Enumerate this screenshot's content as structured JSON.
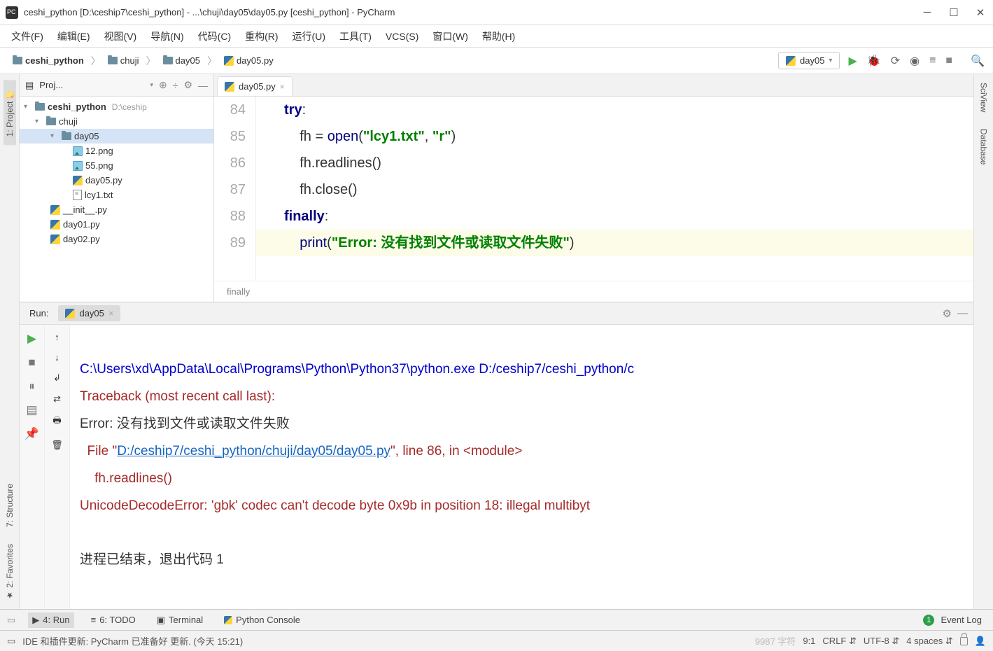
{
  "window": {
    "title": "ceshi_python [D:\\ceship7\\ceshi_python] - ...\\chuji\\day05\\day05.py [ceshi_python] - PyCharm"
  },
  "menu": [
    "文件(F)",
    "编辑(E)",
    "视图(V)",
    "导航(N)",
    "代码(C)",
    "重构(R)",
    "运行(U)",
    "工具(T)",
    "VCS(S)",
    "窗口(W)",
    "帮助(H)"
  ],
  "breadcrumb": {
    "items": [
      "ceshi_python",
      "chuji",
      "day05",
      "day05.py"
    ]
  },
  "runconfig": "day05",
  "project": {
    "title": "Proj...",
    "root": {
      "name": "ceshi_python",
      "path": "D:\\ceship"
    },
    "tree": {
      "chuji": "chuji",
      "day05": "day05",
      "files": [
        "12.png",
        "55.png",
        "day05.py",
        "lcy1.txt"
      ],
      "more": [
        "__init__.py",
        "day01.py",
        "day02.py"
      ]
    }
  },
  "tabs": {
    "items": [
      {
        "label": "day05.py"
      }
    ]
  },
  "code": {
    "lines": [
      {
        "n": 84,
        "html": "<span class='kw'>try</span>:"
      },
      {
        "n": 85,
        "html": "    fh = <span class='fn'>open</span>(<span class='str'>\"lcy1.txt\"</span>, <span class='str'>\"r\"</span>)"
      },
      {
        "n": 86,
        "html": "    fh.readlines()"
      },
      {
        "n": 87,
        "html": "    fh.close()"
      },
      {
        "n": 88,
        "html": "<span class='kw'>finally</span>:"
      },
      {
        "n": 89,
        "html": "    <span class='fn'>print</span>(<span class='str'>\"Error: 没有找到文件或读取文件失败\"</span>)",
        "hl": true
      }
    ],
    "context": "finally"
  },
  "run": {
    "label": "Run:",
    "tab": "day05",
    "output": {
      "l1": "C:\\Users\\xd\\AppData\\Local\\Programs\\Python\\Python37\\python.exe D:/ceship7/ceshi_python/c",
      "l2": "Traceback (most recent call last):",
      "l3": "Error: 没有找到文件或读取文件失败",
      "l4a": "  File \"",
      "l4link": "D:/ceship7/ceshi_python/chuji/day05/day05.py",
      "l4b": "\", line 86, in <module>",
      "l5": "    fh.readlines()",
      "l6": "UnicodeDecodeError: 'gbk' codec can't decode byte 0x9b in position 18: illegal multibyt",
      "l8": "进程已结束，退出代码 1"
    }
  },
  "bottomtabs": {
    "run": "4: Run",
    "todo": "6: TODO",
    "terminal": "Terminal",
    "pyconsole": "Python Console",
    "eventlog": "Event Log"
  },
  "status": {
    "msg": "IDE 和插件更新: PyCharm 已准备好 更新. (今天 15:21)",
    "sub": "9987 字符",
    "pos": "9:1",
    "eol": "CRLF",
    "enc": "UTF-8",
    "indent": "4 spaces"
  },
  "leftgutter": {
    "project": "1: Project",
    "structure": "7: Structure",
    "favorites": "2: Favorites"
  },
  "rightgutter": {
    "sciview": "SciView",
    "database": "Database"
  }
}
